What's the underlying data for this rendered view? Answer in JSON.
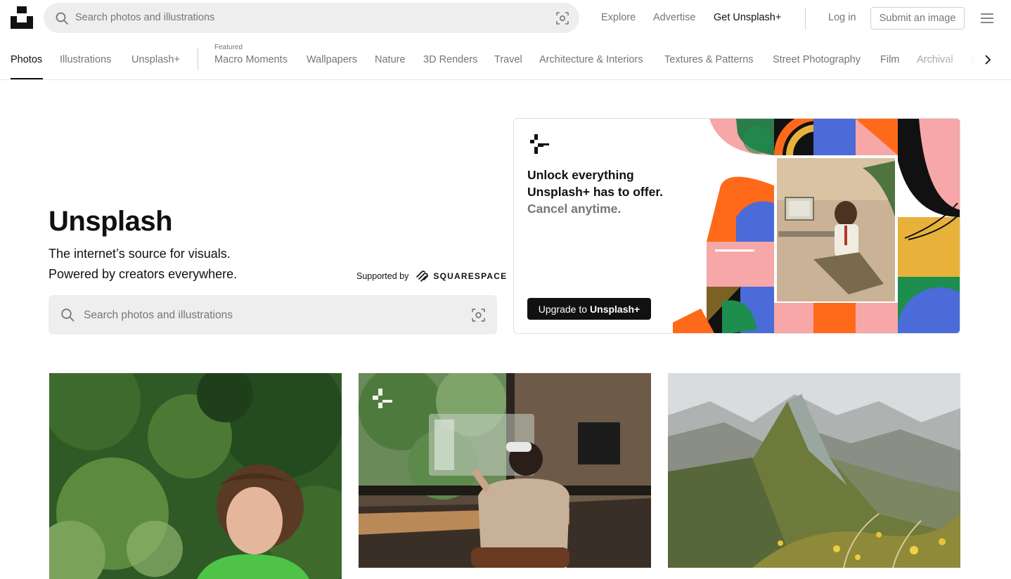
{
  "header": {
    "search_placeholder": "Search photos and illustrations",
    "nav": {
      "explore": "Explore",
      "advertise": "Advertise",
      "get_plus": "Get Unsplash+",
      "login": "Log in",
      "submit": "Submit an image"
    }
  },
  "tabs": {
    "items": [
      "Photos",
      "Illustrations",
      "Unsplash+"
    ],
    "featured_label": "Featured",
    "topics": [
      "Macro Moments",
      "Wallpapers",
      "Nature",
      "3D Renders",
      "Travel",
      "Architecture & Interiors",
      "Textures & Patterns",
      "Street Photography",
      "Film",
      "Archival",
      "E"
    ],
    "active": "Photos"
  },
  "hero": {
    "title": "Unsplash",
    "subtitle_line1": "The internet’s source for visuals.",
    "subtitle_line2": "Powered by creators everywhere.",
    "supported_by": "Supported by",
    "sponsor": "SQUARESPACE",
    "search_placeholder": "Search photos and illustrations"
  },
  "promo": {
    "line1": "Unlock everything",
    "line2": "Unsplash+ has to offer.",
    "line3": "Cancel anytime.",
    "button_prefix": "Upgrade to",
    "button_bold": "Unsplash+"
  },
  "colors": {
    "accent": "#111111",
    "muted": "#767676",
    "search_bg": "#eeeeee"
  }
}
